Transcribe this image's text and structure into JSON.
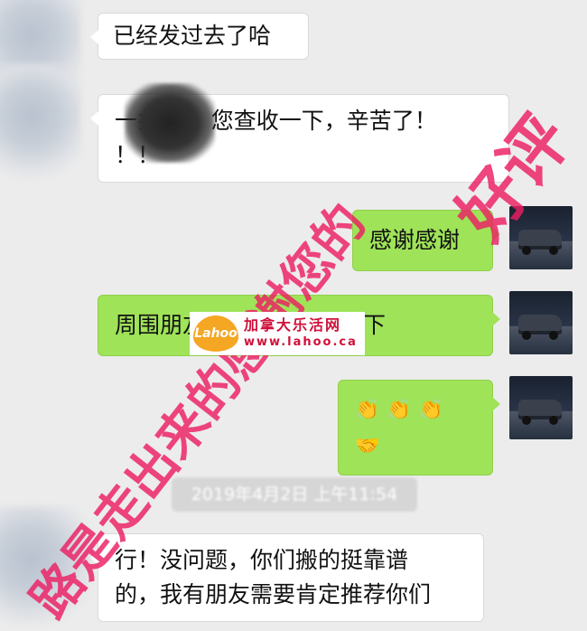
{
  "messages": [
    {
      "id": "m1",
      "side": "in",
      "text": "已经发过去了哈"
    },
    {
      "id": "m2",
      "side": "in",
      "line1": "一共95，您查收一下，辛苦了！",
      "line2": "！！"
    },
    {
      "id": "m3",
      "side": "out",
      "text": "感谢感谢"
    },
    {
      "id": "m4",
      "side": "out",
      "text": "周围朋友有需要麻烦您推下"
    },
    {
      "id": "m5",
      "side": "out",
      "icons": [
        "clap-hands-icon",
        "clap-hands-icon",
        "clap-hands-icon",
        "handshake-icon"
      ],
      "glyphs": [
        "👏",
        "👏",
        "👏",
        "🤝"
      ]
    },
    {
      "id": "m6",
      "side": "in",
      "line1": "行！没问题，你们搬的挺靠谱",
      "line2": "的，我有朋友需要肯定推荐你们"
    }
  ],
  "timestamp": "2019年4月2日 上午11:54",
  "watermark": {
    "line1": "好评",
    "line2": "路是走出来的感谢您的",
    "color": "#ec1e63"
  },
  "stamp": {
    "logo_text": "Lahoo",
    "name": "加拿大乐活网",
    "url": "www.lahoo.ca"
  },
  "colors": {
    "outgoing_bubble": "#9fe358",
    "incoming_bubble": "#ffffff",
    "background": "#ececec"
  }
}
